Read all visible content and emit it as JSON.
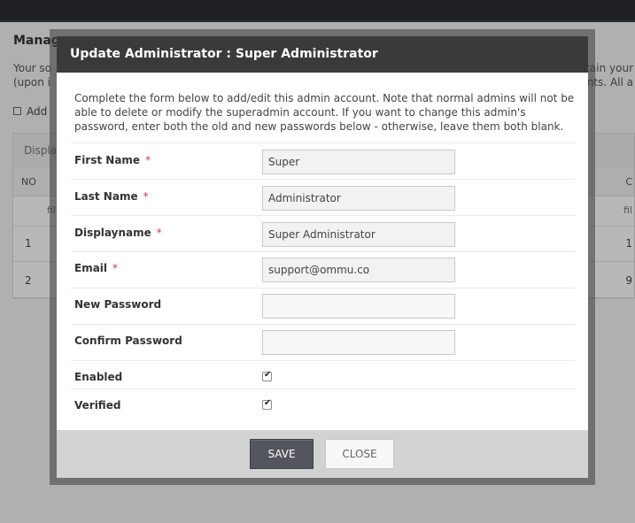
{
  "background": {
    "title": "Manag",
    "line1": "Your so",
    "line1_right": "tain your",
    "line2": "(upon i",
    "line2_right": "nts. All a",
    "add_link": "Add",
    "table": {
      "display_label": "Displa",
      "col_no": "NO",
      "col_right": "C",
      "filter_left": "fil",
      "filter_right": "fil",
      "rows": [
        {
          "no": "1",
          "right": "1"
        },
        {
          "no": "2",
          "right": "9"
        }
      ]
    }
  },
  "dialog": {
    "title": "Update Administrator : Super Administrator",
    "intro": "Complete the form below to add/edit this admin account. Note that normal admins will not be able to delete or modify the superadmin account. If you want to change this admin's password, enter both the old and new passwords below - otherwise, leave them both blank.",
    "required_marker": "*",
    "fields": {
      "first_name": {
        "label": "First Name",
        "value": "Super"
      },
      "last_name": {
        "label": "Last Name",
        "value": "Administrator"
      },
      "displayname": {
        "label": "Displayname",
        "value": "Super Administrator"
      },
      "email": {
        "label": "Email",
        "value": "support@ommu.co"
      },
      "new_password": {
        "label": "New Password",
        "value": ""
      },
      "confirm_password": {
        "label": "Confirm Password",
        "value": ""
      }
    },
    "checkboxes": {
      "enabled": {
        "label": "Enabled",
        "checked": true,
        "mark": "✔"
      },
      "verified": {
        "label": "Verified",
        "checked": true,
        "mark": "✔"
      }
    },
    "buttons": {
      "save": "SAVE",
      "close": "CLOSE"
    }
  },
  "colors": {
    "header_bg": "#3a3a3a",
    "footer_bg": "#d2d2d2",
    "save_bg": "#53565c",
    "required": "#dd3333"
  }
}
